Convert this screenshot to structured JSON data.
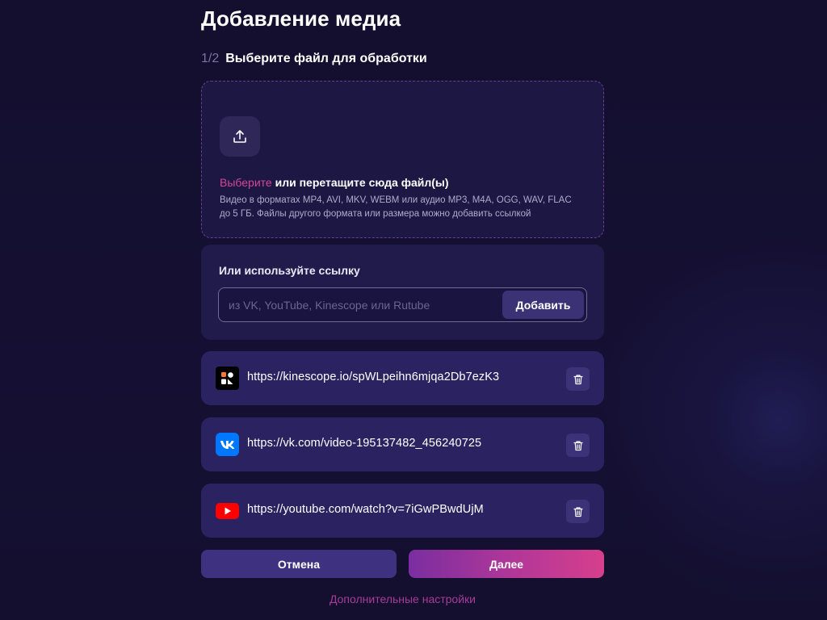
{
  "header": {
    "title": "Добавление медиа",
    "step_number": "1/2",
    "step_title": "Выберите файл для обработки"
  },
  "dropzone": {
    "icon": "upload-icon",
    "pick_link": "Выберите",
    "title_rest": "или перетащите сюда файл(ы)",
    "description_line1": "Видео в форматах MP4, AVI, MKV, WEBM или аудио MP3, M4A, OGG, WAV, FLAC",
    "description_line2": "до 5 ГБ. Файлы другого формата или размера можно добавить ссылкой"
  },
  "link_section": {
    "title": "Или используйте ссылку",
    "input_value": "",
    "input_placeholder": "из VK, YouTube, Kinescope или Rutube",
    "add_button": "Добавить"
  },
  "media_items": [
    {
      "service": "kinescope",
      "icon": "kinescope-logo-icon",
      "url": "https://kinescope.io/spWLpeihn6mjqa2Db7ezK3"
    },
    {
      "service": "vk",
      "icon": "vk-logo-icon",
      "url": "https://vk.com/video-195137482_456240725"
    },
    {
      "service": "youtube",
      "icon": "youtube-logo-icon",
      "url": "https://youtube.com/watch?v=7iGwPBwdUjM"
    }
  ],
  "footer": {
    "cancel_button": "Отмена",
    "next_button": "Далее",
    "more_settings": "Дополнительные настройки"
  },
  "colors": {
    "background": "#140f2e",
    "accent_pink": "#d4479a",
    "button_gradient_start": "#7a2ea0",
    "button_gradient_end": "#d63f8c",
    "vk_blue": "#0077ff",
    "youtube_red": "#ff0000"
  }
}
